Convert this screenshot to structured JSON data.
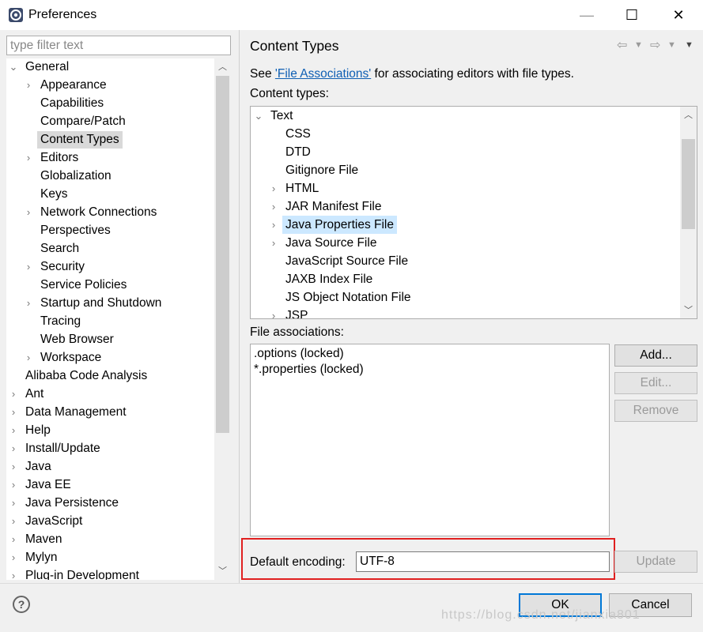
{
  "window": {
    "title": "Preferences",
    "minimize": "—",
    "maximize": "☐",
    "close": "✕"
  },
  "sidebar": {
    "filter_placeholder": "type filter text",
    "items": [
      {
        "label": "General",
        "expander": "⌄"
      },
      {
        "label": "Appearance",
        "expander": "›"
      },
      {
        "label": "Capabilities",
        "expander": ""
      },
      {
        "label": "Compare/Patch",
        "expander": ""
      },
      {
        "label": "Content Types",
        "expander": ""
      },
      {
        "label": "Editors",
        "expander": "›"
      },
      {
        "label": "Globalization",
        "expander": ""
      },
      {
        "label": "Keys",
        "expander": ""
      },
      {
        "label": "Network Connections",
        "expander": "›"
      },
      {
        "label": "Perspectives",
        "expander": ""
      },
      {
        "label": "Search",
        "expander": ""
      },
      {
        "label": "Security",
        "expander": "›"
      },
      {
        "label": "Service Policies",
        "expander": ""
      },
      {
        "label": "Startup and Shutdown",
        "expander": "›"
      },
      {
        "label": "Tracing",
        "expander": ""
      },
      {
        "label": "Web Browser",
        "expander": ""
      },
      {
        "label": "Workspace",
        "expander": "›"
      },
      {
        "label": "Alibaba Code Analysis",
        "expander": ""
      },
      {
        "label": "Ant",
        "expander": "›"
      },
      {
        "label": "Data Management",
        "expander": "›"
      },
      {
        "label": "Help",
        "expander": "›"
      },
      {
        "label": "Install/Update",
        "expander": "›"
      },
      {
        "label": "Java",
        "expander": "›"
      },
      {
        "label": "Java EE",
        "expander": "›"
      },
      {
        "label": "Java Persistence",
        "expander": "›"
      },
      {
        "label": "JavaScript",
        "expander": "›"
      },
      {
        "label": "Maven",
        "expander": "›"
      },
      {
        "label": "Mylyn",
        "expander": "›"
      },
      {
        "label": "Plug-in Development",
        "expander": "›"
      }
    ],
    "selected": "Content Types"
  },
  "main": {
    "title": "Content Types",
    "see_prefix": "See ",
    "see_link": "'File Associations'",
    "see_suffix": " for associating editors with file types.",
    "content_types_label": "Content types:",
    "content_types": [
      {
        "label": "Text",
        "expander": "⌄"
      },
      {
        "label": "CSS",
        "expander": ""
      },
      {
        "label": "DTD",
        "expander": ""
      },
      {
        "label": "Gitignore File",
        "expander": ""
      },
      {
        "label": "HTML",
        "expander": "›"
      },
      {
        "label": "JAR Manifest File",
        "expander": "›"
      },
      {
        "label": "Java Properties File",
        "expander": "›"
      },
      {
        "label": "Java Source File",
        "expander": "›"
      },
      {
        "label": "JavaScript Source File",
        "expander": ""
      },
      {
        "label": "JAXB Index File",
        "expander": ""
      },
      {
        "label": "JS Object Notation File",
        "expander": ""
      },
      {
        "label": "JSP",
        "expander": "›"
      }
    ],
    "selected_content_type": "Java Properties File",
    "file_assoc_label": "File associations:",
    "file_associations": [
      ".options (locked)",
      "*.properties (locked)"
    ],
    "add_button": "Add...",
    "edit_button": "Edit...",
    "remove_button": "Remove",
    "encoding_label": "Default encoding:",
    "encoding_value": "UTF-8",
    "update_button": "Update"
  },
  "footer": {
    "help": "?",
    "ok_button": "OK",
    "cancel_button": "Cancel",
    "watermark": "https://blog.csdn.net/jianxia801"
  },
  "colors": {
    "accent": "#0078d7",
    "highlight_box": "#e02020",
    "link": "#0f5fb4",
    "selection_blue": "#cce8ff",
    "selection_gray": "#d9d9d9"
  }
}
